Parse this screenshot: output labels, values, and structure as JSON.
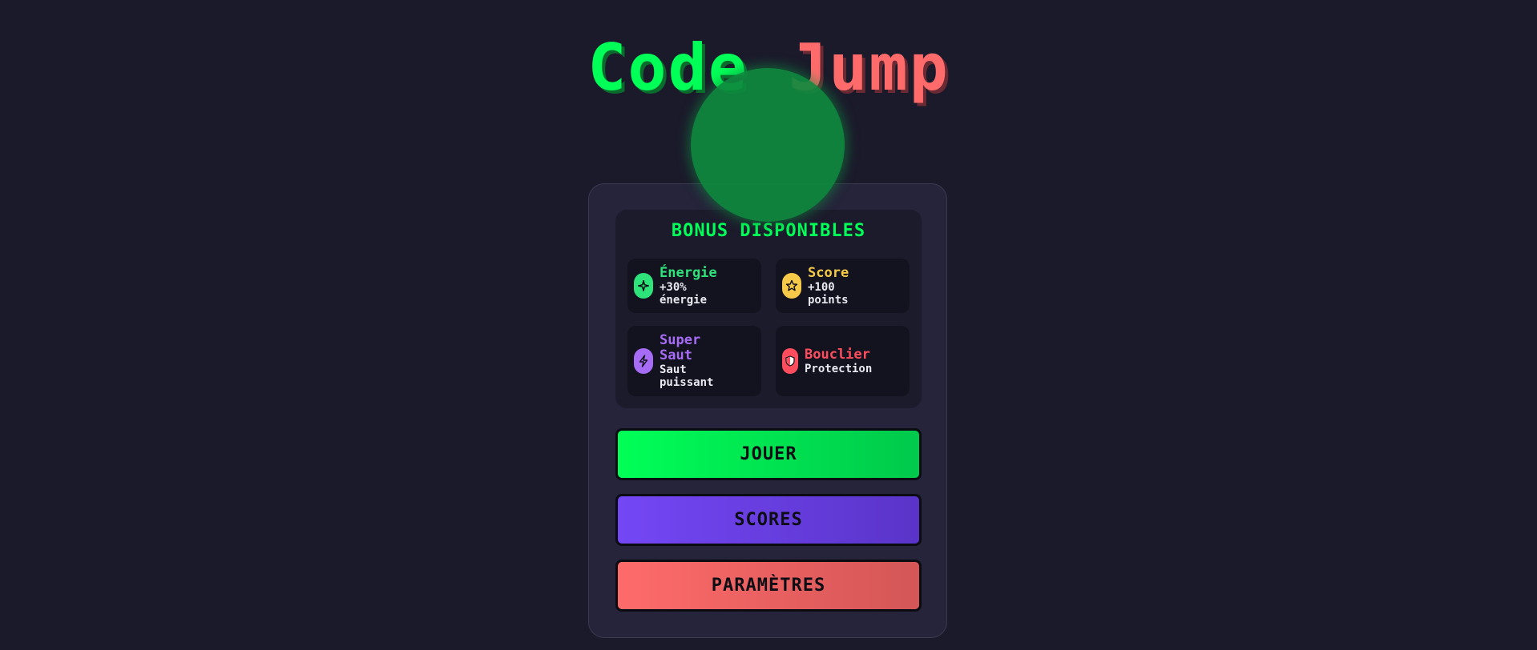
{
  "title": {
    "word1": "Code",
    "word2": "Jump"
  },
  "bonus": {
    "heading": "BONUS DISPONIBLES",
    "items": [
      {
        "name": "Énergie",
        "desc_line1": "+30%",
        "desc_line2": "énergie",
        "color": "#2de37a",
        "icon": "sparkle-icon"
      },
      {
        "name": "Score",
        "desc_line1": "+100",
        "desc_line2": "points",
        "color": "#f7c948",
        "icon": "star-icon"
      },
      {
        "name_line1": "Super",
        "name_line2": "Saut",
        "desc_line1": "Saut",
        "desc_line2": "puissant",
        "color": "#a66cf5",
        "icon": "lightning-icon"
      },
      {
        "name": "Bouclier",
        "desc_line1": "Protection",
        "color": "#ff4d5e",
        "icon": "shield-icon"
      }
    ]
  },
  "buttons": {
    "play": "JOUER",
    "scores": "SCORES",
    "settings": "PARAMÈTRES"
  },
  "colors": {
    "background": "#1b1a2b",
    "accent_green": "#00ff57",
    "accent_red": "#ff6b6b",
    "accent_purple": "#7447f5"
  }
}
